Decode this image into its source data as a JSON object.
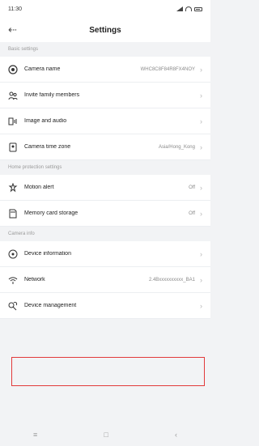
{
  "status": {
    "time": "11:30"
  },
  "header": {
    "back_glyph": "⇠",
    "title": "Settings"
  },
  "sections": [
    {
      "title": "Basic settings",
      "items": [
        {
          "name": "camera-name",
          "label": "Camera name",
          "value": "WHC8C8F84R8FX4NOY",
          "icon": "camera-icon"
        },
        {
          "name": "invite-family",
          "label": "Invite family members",
          "value": "",
          "icon": "people-icon"
        },
        {
          "name": "image-audio",
          "label": "Image and audio",
          "value": "",
          "icon": "image-audio-icon"
        },
        {
          "name": "time-zone",
          "label": "Camera time zone",
          "value": "Asia/Hong_Kong",
          "icon": "globe-icon"
        }
      ]
    },
    {
      "title": "Home protection settings",
      "items": [
        {
          "name": "motion-alert",
          "label": "Motion alert",
          "value": "Off",
          "icon": "alert-icon"
        },
        {
          "name": "memory-card",
          "label": "Memory card storage",
          "value": "Off",
          "icon": "memory-card-icon"
        }
      ]
    },
    {
      "title": "Camera info",
      "items": [
        {
          "name": "device-info",
          "label": "Device information",
          "value": "",
          "icon": "info-icon"
        },
        {
          "name": "network",
          "label": "Network",
          "value": "2.4Bxxxxxxxxxx_BA1",
          "icon": "wifi-icon"
        },
        {
          "name": "device-management",
          "label": "Device management",
          "value": "",
          "icon": "wrench-icon"
        }
      ]
    }
  ],
  "chevron": "›",
  "bottom_nav": {
    "menu": "≡",
    "home": "□",
    "back": "‹"
  },
  "colors": {
    "highlight": "#e23a3a",
    "background": "#f2f3f5"
  }
}
